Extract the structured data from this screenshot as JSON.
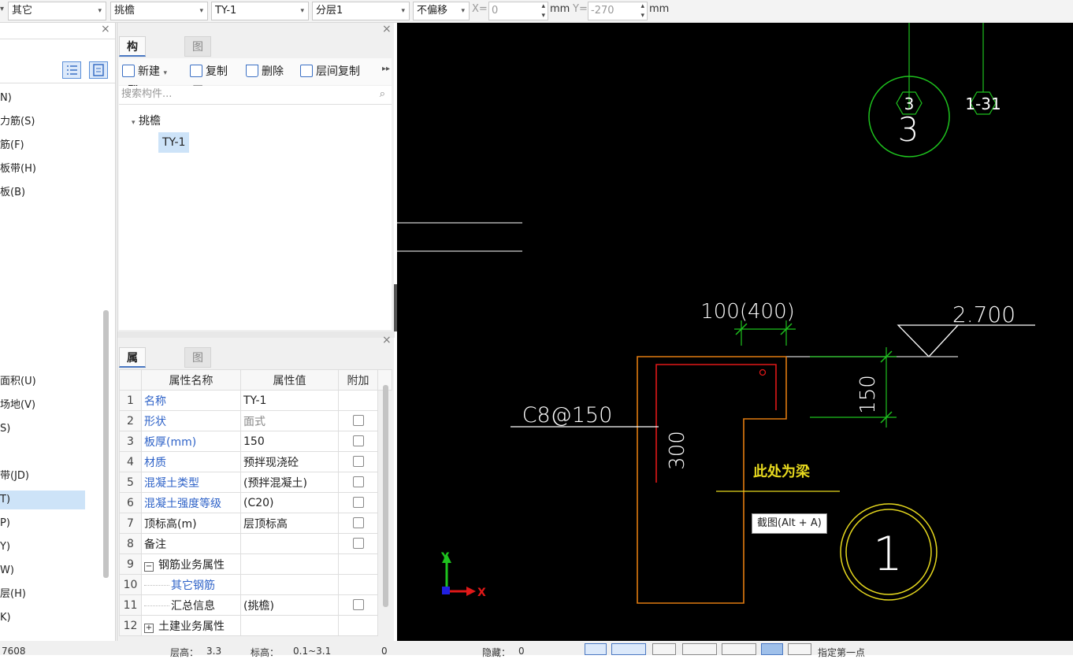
{
  "toolbar": {
    "type_select": "其它",
    "component_select": "挑檐",
    "name_select": "TY-1",
    "floor_select": "分层1",
    "offset_select": "不偏移",
    "x_label": "X=",
    "x_value": "0",
    "unit_x": "mm",
    "y_label": "Y=",
    "y_value": "-270",
    "unit_y": "mm"
  },
  "left_panel": {
    "items_top": [
      "N)",
      "力筋(S)",
      "筋(F)",
      "板带(H)",
      "板(B)"
    ],
    "items_bottom": [
      "面积(U)",
      "场地(V)",
      "S)",
      "带(JD)",
      "T)",
      "P)",
      "Y)",
      "W)",
      "层(H)",
      "K)"
    ],
    "selected_index": 4
  },
  "component_panel": {
    "tabs": [
      "构件列表",
      "图纸管理"
    ],
    "new_label": "新建",
    "copy_label": "复制",
    "delete_label": "删除",
    "floor_copy_label": "层间复制",
    "search_placeholder": "搜索构件...",
    "tree_group": "挑檐",
    "tree_item": "TY-1"
  },
  "property_panel": {
    "tabs": [
      "属性列表",
      "图层管理"
    ],
    "headers": [
      "属性名称",
      "属性值",
      "附加"
    ],
    "rows": [
      {
        "no": "1",
        "name": "名称",
        "value": "TY-1",
        "blue": true,
        "check": false,
        "gray": false
      },
      {
        "no": "2",
        "name": "形状",
        "value": "面式",
        "blue": true,
        "check": true,
        "gray": true
      },
      {
        "no": "3",
        "name": "板厚(mm)",
        "value": "150",
        "blue": true,
        "check": true,
        "gray": false
      },
      {
        "no": "4",
        "name": "材质",
        "value": "预拌现浇砼",
        "blue": true,
        "check": true,
        "gray": false
      },
      {
        "no": "5",
        "name": "混凝土类型",
        "value": "(预拌混凝土)",
        "blue": true,
        "check": true,
        "gray": false
      },
      {
        "no": "6",
        "name": "混凝土强度等级",
        "value": "(C20)",
        "blue": true,
        "check": true,
        "gray": false
      },
      {
        "no": "7",
        "name": "顶标高(m)",
        "value": "层顶标高",
        "blue": false,
        "check": true,
        "gray": false
      },
      {
        "no": "8",
        "name": "备注",
        "value": "",
        "blue": false,
        "check": true,
        "gray": false
      },
      {
        "no": "9",
        "name": "钢筋业务属性",
        "value": "",
        "blue": false,
        "check": false,
        "gray": false,
        "group": "−"
      },
      {
        "no": "10",
        "name": "其它钢筋",
        "value": "",
        "blue": true,
        "check": false,
        "gray": false,
        "child": true
      },
      {
        "no": "11",
        "name": "汇总信息",
        "value": "(挑檐)",
        "blue": false,
        "check": true,
        "gray": false,
        "child": true
      },
      {
        "no": "12",
        "name": "土建业务属性",
        "value": "",
        "blue": false,
        "check": false,
        "gray": false,
        "group": "+"
      }
    ]
  },
  "canvas": {
    "axis_top_left": "3",
    "axis_top_right": "1-31",
    "axis_bottom": "1",
    "dim_width": "100(400)",
    "elevation": "2.700",
    "dim_thick": "150",
    "rebar_label": "C8@150",
    "dim_height": "300",
    "note": "此处为梁",
    "tooltip": "截图(Alt + A)",
    "axis_x": "X",
    "axis_y": "Y"
  },
  "statusbar": {
    "coord": "7608",
    "floor_height_label": "层高：",
    "floor_height": "3.3",
    "elevation_label": "标高：",
    "elevation": "0.1~3.1",
    "count": "0",
    "hidden_label": "隐藏：",
    "hidden": "0",
    "hint": "指定第一点"
  }
}
